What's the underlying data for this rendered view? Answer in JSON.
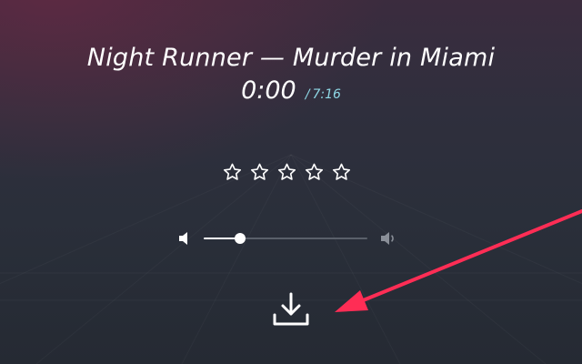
{
  "player": {
    "title": "Night Runner — Murder in Miami",
    "current_time": "0:00",
    "time_separator": "/",
    "total_time": "7:16"
  },
  "rating": {
    "max_stars": 5,
    "value": 0,
    "icon": "star-outline-icon"
  },
  "volume": {
    "level": 0.22,
    "min_icon": "volume-low-icon",
    "max_icon": "volume-high-icon"
  },
  "download": {
    "icon": "download-icon"
  },
  "annotation": {
    "type": "arrow",
    "color": "#ff2d55",
    "points_to": "download-button"
  },
  "colors": {
    "accent": "#8fd8e6",
    "text": "#ffffff",
    "arrow": "#ff2d55",
    "muted_icon": "#8a8f98"
  }
}
